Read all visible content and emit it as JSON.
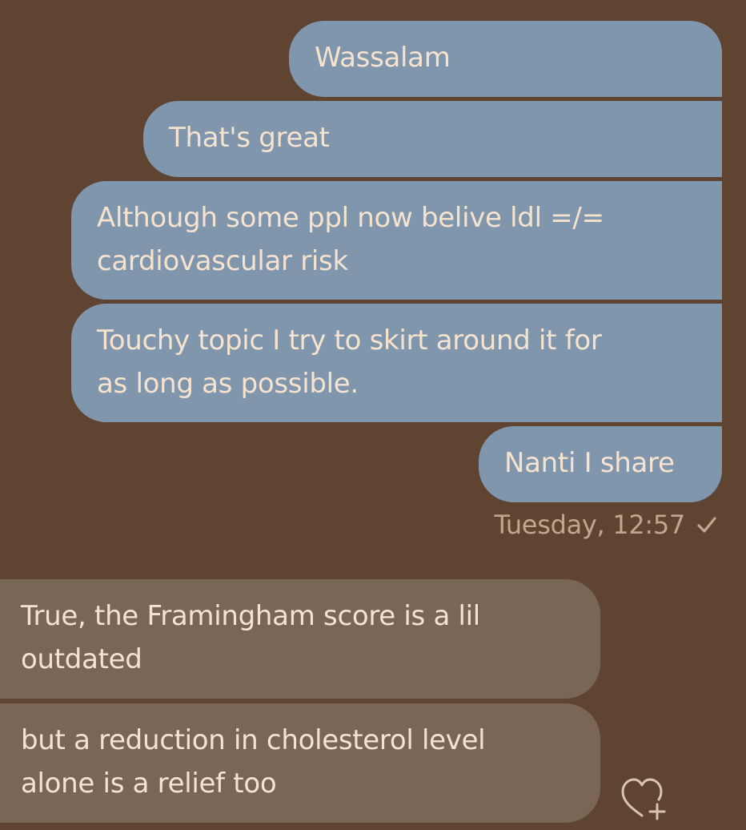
{
  "conversation": {
    "outgoing": [
      {
        "lines": [
          "Wassalam"
        ]
      },
      {
        "lines": [
          "That's great"
        ]
      },
      {
        "lines": [
          "Although some ppl now belive ldl =/=",
          "cardiovascular risk"
        ]
      },
      {
        "lines": [
          "Touchy topic I try to skirt around it for",
          "as long as possible."
        ]
      },
      {
        "lines": [
          "Nanti I share"
        ]
      }
    ],
    "status": {
      "timestamp": "Tuesday, 12:57",
      "icon": "check-icon"
    },
    "incoming": [
      {
        "lines": [
          "True, the Framingham score is a lil",
          "outdated"
        ]
      },
      {
        "lines": [
          "but a reduction in cholesterol level",
          "alone is a relief too"
        ]
      }
    ],
    "reaction_icon": "heart-plus-icon"
  },
  "colors": {
    "background": "#5e4431",
    "outgoing_bubble": "#8096ad",
    "incoming_bubble": "#7a6655",
    "text": "#f6e3cf",
    "timestamp": "#bfa790"
  }
}
